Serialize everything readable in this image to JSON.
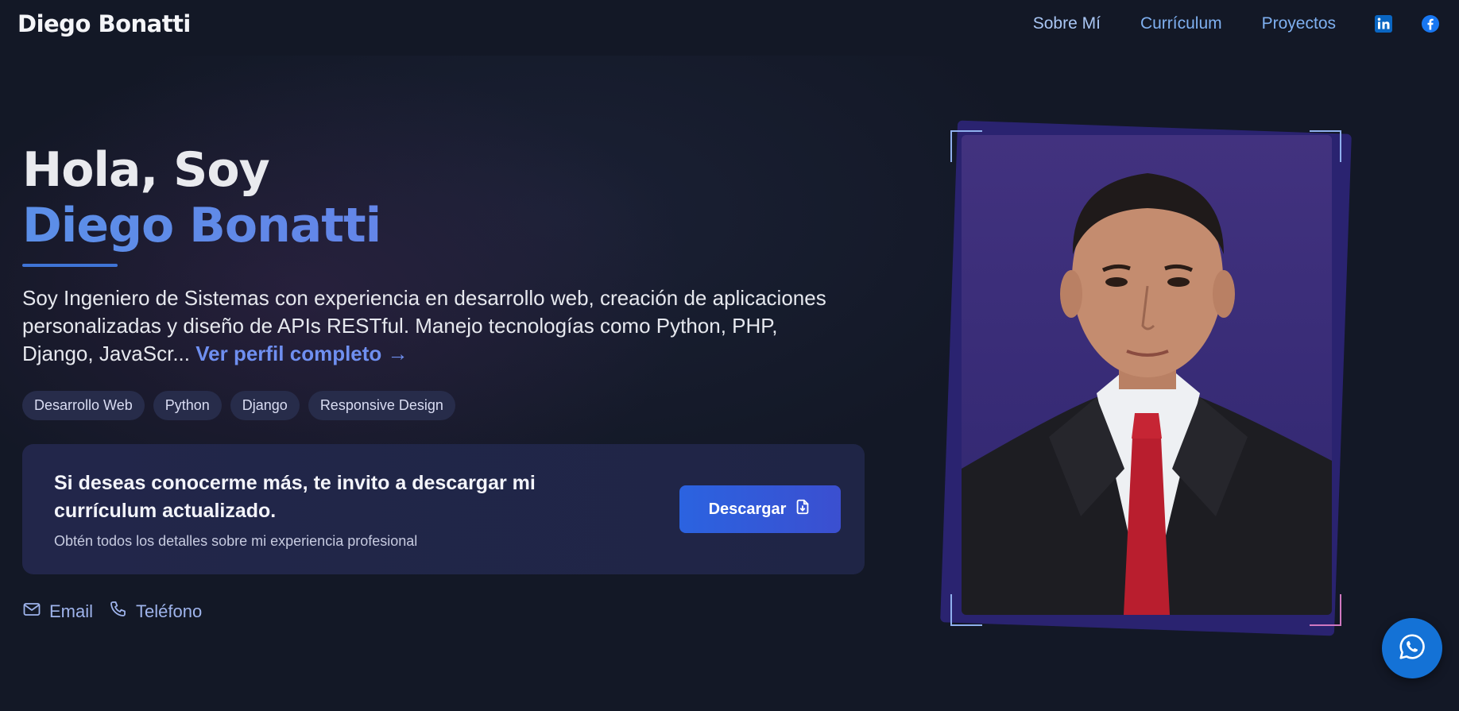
{
  "header": {
    "brand": "Diego Bonatti",
    "nav": [
      {
        "label": "Sobre Mí"
      },
      {
        "label": "Currículum"
      },
      {
        "label": "Proyectos"
      }
    ],
    "social": [
      "linkedin-icon",
      "facebook-icon"
    ]
  },
  "hero": {
    "greeting": "Hola, Soy",
    "name": "Diego Bonatti",
    "bio": "Soy Ingeniero de Sistemas con experiencia en desarrollo web, creación de aplicaciones personalizadas y diseño de APIs RESTful. Manejo tecnologías como Python, PHP, Django, JavaScr...",
    "bio_link": "Ver perfil completo →",
    "tags": [
      "Desarrollo Web",
      "Python",
      "Django",
      "Responsive Design"
    ]
  },
  "cta": {
    "title": "Si deseas conocerme más, te invito a descargar mi currículum actualizado.",
    "subtitle": "Obtén todos los detalles sobre mi experiencia profesional",
    "button_label": "Descargar"
  },
  "contacts": [
    {
      "label": "Email",
      "icon": "mail-icon"
    },
    {
      "label": "Teléfono",
      "icon": "phone-icon"
    }
  ],
  "colors": {
    "background": "#131826",
    "accent": "#2b63e0",
    "link": "#6f8ff0",
    "whatsapp": "#1472d6"
  }
}
